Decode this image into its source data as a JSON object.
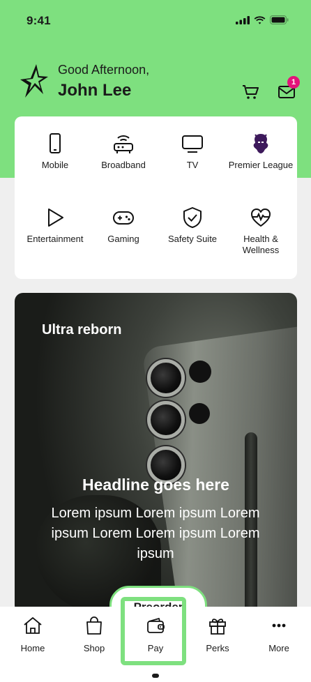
{
  "status_bar": {
    "time": "9:41"
  },
  "header": {
    "greeting": "Good Afternoon,",
    "user_name": "John Lee",
    "notification_count": "1"
  },
  "services": [
    {
      "label": "Mobile",
      "icon": "mobile-phone-icon"
    },
    {
      "label": "Broadband",
      "icon": "router-icon"
    },
    {
      "label": "TV",
      "icon": "tv-icon"
    },
    {
      "label": "Premier League",
      "icon": "premier-league-lion-icon"
    },
    {
      "label": "Entertainment",
      "icon": "play-icon"
    },
    {
      "label": "Gaming",
      "icon": "gamepad-icon"
    },
    {
      "label": "Safety Suite",
      "icon": "shield-check-icon"
    },
    {
      "label": "Health & Wellness",
      "icon": "heart-pulse-icon"
    }
  ],
  "banner": {
    "title": "Ultra reborn",
    "headline": "Headline goes here",
    "body": "Lorem ipsum Lorem ipsum Lorem ipsum Lorem  Lorem ipsum Lorem ipsum",
    "cta": "Preorder"
  },
  "tabbar": {
    "items": [
      {
        "label": "Home",
        "icon": "home-icon"
      },
      {
        "label": "Shop",
        "icon": "shopping-bag-icon"
      },
      {
        "label": "Pay",
        "icon": "wallet-icon"
      },
      {
        "label": "Perks",
        "icon": "gift-icon"
      },
      {
        "label": "More",
        "icon": "more-dots-icon"
      }
    ],
    "active": "Pay"
  },
  "colors": {
    "brand_green": "#7ee07f",
    "badge_pink": "#e3137a",
    "premier_league_purple": "#3d195b"
  }
}
